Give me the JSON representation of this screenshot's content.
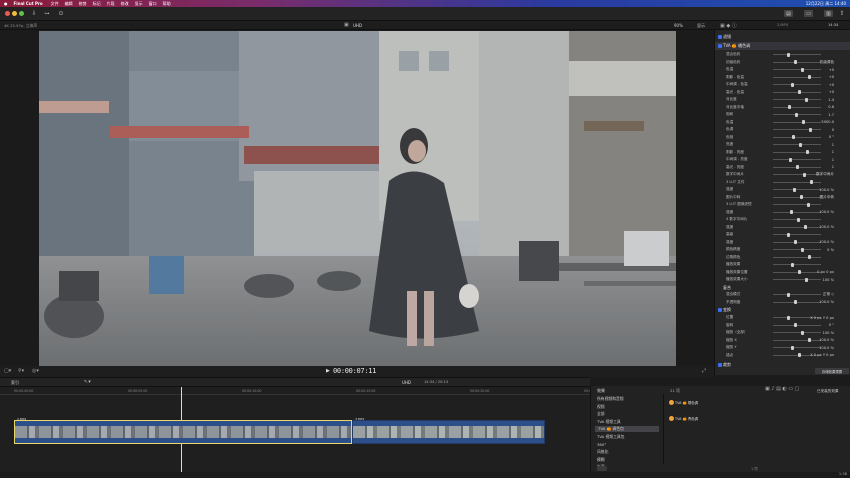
{
  "menubar": {
    "app_name": "Final Cut Pro",
    "items": [
      "文件",
      "编辑",
      "修剪",
      "标记",
      "片段",
      "修改",
      "显示",
      "窗口",
      "帮助"
    ],
    "clock": "12月22日 周二 14:40"
  },
  "infobar": {
    "format": "4K 25.97p, 立体声",
    "project": "UHD",
    "zoom": "90%",
    "view_label": "显示",
    "clip_name": "2.MP4",
    "duration": "14:34"
  },
  "viewer": {
    "timecode": "00:00:07:11"
  },
  "inspector": {
    "top_section": "滤镜",
    "effect_name": "TVA 🍊 橘色调",
    "rows": [
      {
        "label": "混合色彩",
        "value": ""
      },
      {
        "label": "初级色彩",
        "value": "初级调色"
      },
      {
        "label": "色温",
        "value": "+0"
      },
      {
        "label": "阴影 - 色温",
        "value": "+0"
      },
      {
        "label": "中间调 - 色温",
        "value": "+0"
      },
      {
        "label": "高光 - 色温",
        "value": "+0"
      },
      {
        "label": "对比度",
        "value": "1.4"
      },
      {
        "label": "对比度中轴",
        "value": "0.6"
      },
      {
        "label": "饱和",
        "value": "1.7"
      },
      {
        "label": "色温",
        "value": "5000.0"
      },
      {
        "label": "色调",
        "value": "0"
      },
      {
        "label": "色相",
        "value": "0 °"
      },
      {
        "label": "亮度",
        "value": "1"
      },
      {
        "label": "阴影 - 亮度",
        "value": "1"
      },
      {
        "label": "中间调 - 亮度",
        "value": "1"
      },
      {
        "label": "高光 - 亮度",
        "value": "1"
      },
      {
        "label": "数字中间片",
        "value": "数字中间片"
      },
      {
        "label": "3 LUT 文件",
        "value": ""
      },
      {
        "label": "强度",
        "value": "100.0 %"
      },
      {
        "label": "图片中转",
        "value": "图片中转"
      },
      {
        "label": "3 LUT 图像滤镜",
        "value": ""
      },
      {
        "label": "强度",
        "value": "100.0 %"
      },
      {
        "label": "4 数字中间片",
        "value": ""
      },
      {
        "label": "强度",
        "value": "100.0 %"
      },
      {
        "label": "高级",
        "value": ""
      },
      {
        "label": "强度",
        "value": "100.0 %"
      },
      {
        "label": "颜色精度",
        "value": "0 %"
      },
      {
        "label": "边角颜色",
        "value": ""
      },
      {
        "label": "播放效果",
        "value": ""
      },
      {
        "label": "播放效果位置",
        "value": "0 px   0 px"
      },
      {
        "label": "播放效果大小",
        "value": "100 %"
      }
    ],
    "compositing_header": "复合",
    "compositing": [
      {
        "label": "混合模式",
        "value": "正常 ◇"
      },
      {
        "label": "不透明度",
        "value": "100.0 %"
      }
    ],
    "transform_header": "变换",
    "transform": [
      {
        "label": "位置",
        "value": "X  0 px   Y  0 px"
      },
      {
        "label": "旋转",
        "value": "0 °"
      },
      {
        "label": "缩放（全部）",
        "value": "100 %"
      },
      {
        "label": "缩放 X",
        "value": "100.0 %"
      },
      {
        "label": "缩放 Y",
        "value": "100.0 %"
      },
      {
        "label": "锚点",
        "value": "X  0 px   Y  0 px"
      }
    ],
    "bottom_header": "裁剪",
    "save_button": "存储效果预置"
  },
  "timeline": {
    "index_label": "索引",
    "project_name": "UHD",
    "position": "14:34 / 20:13",
    "ticks": [
      "00:00:00:00",
      "00:00:05:00",
      "00:00:10:00",
      "00:00:15:00",
      "00:00:20:00",
      "00:00:25:00"
    ],
    "clip1_label": "2.MP4",
    "clip2_label": "3.MP4"
  },
  "effects_browser": {
    "header": "效果",
    "count_label": "21 项",
    "installed_label": "已安装的效果",
    "categories": [
      "所有视频和音频",
      "视频",
      "全部",
      "TVA 视频工具",
      "TVA 🍊 调色包",
      "TVA 视频工具包",
      "360°",
      "风格化",
      "模糊",
      "光源"
    ],
    "selected_index": 4,
    "items": [
      "TVA 🍊 橘色调",
      "TVA 🍊 青色调"
    ],
    "search_placeholder": "搜索",
    "footer_count": "1 项"
  },
  "status": {
    "time": "1:38"
  },
  "colors": {
    "accent": "#3d6ef0",
    "clip_selected": "#e7d66a",
    "clip_fill": "#2c4f8a"
  }
}
